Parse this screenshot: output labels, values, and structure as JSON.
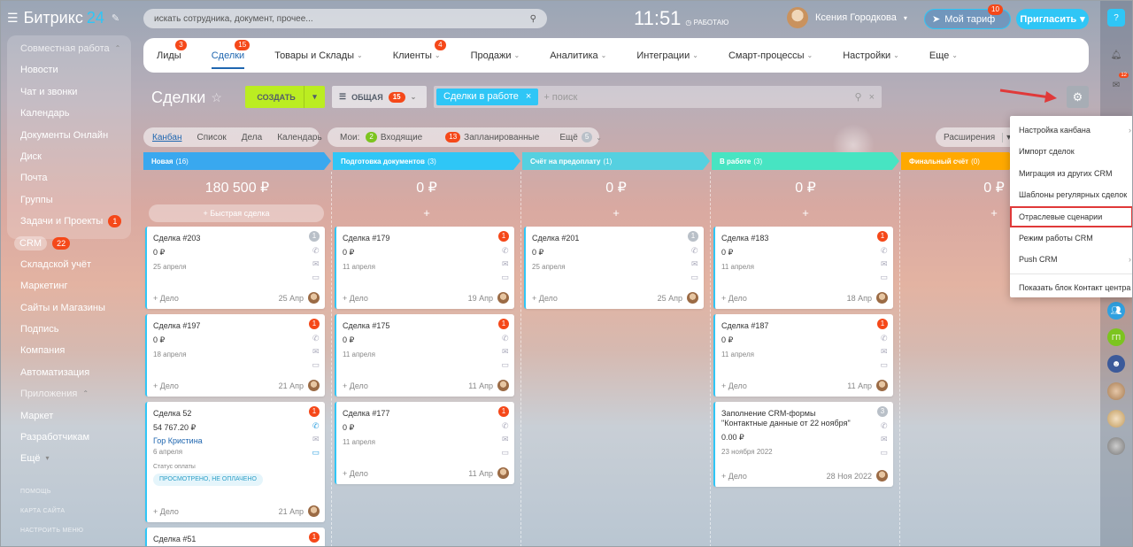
{
  "app": {
    "logo_text": "Битрикс",
    "logo_num": "24"
  },
  "search": {
    "placeholder": "искать сотрудника, документ, прочее..."
  },
  "clock": {
    "time": "11:51",
    "status": "РАБОТАЮ"
  },
  "user": {
    "name": "Ксения Городкова"
  },
  "tariff": {
    "label": "Мой тариф",
    "badge": "10"
  },
  "invite": {
    "label": "Пригласить"
  },
  "sidebar": {
    "group1": "Совместная работа",
    "items": [
      "Новости",
      "Чат и звонки",
      "Календарь",
      "Документы Онлайн",
      "Диск",
      "Почта",
      "Группы"
    ],
    "tasks": "Задачи и Проекты",
    "tasks_badge": "1",
    "crm": "CRM",
    "crm_badge": "22",
    "items2": [
      "Складской учёт",
      "Маркетинг",
      "Сайты и Магазины",
      "Подпись",
      "Компания",
      "Автоматизация"
    ],
    "group2": "Приложения",
    "items3": [
      "Маркет",
      "Разработчикам",
      "Ещё"
    ],
    "footer": [
      "ПОМОЩЬ",
      "КАРТА САЙТА",
      "НАСТРОИТЬ МЕНЮ"
    ]
  },
  "tabs": [
    {
      "label": "Лиды",
      "badge": "3"
    },
    {
      "label": "Сделки",
      "badge": "15"
    },
    {
      "label": "Товары и Склады",
      "badge": ""
    },
    {
      "label": "Клиенты",
      "badge": "4"
    },
    {
      "label": "Продажи",
      "badge": ""
    },
    {
      "label": "Аналитика",
      "badge": ""
    },
    {
      "label": "Интеграции",
      "badge": ""
    },
    {
      "label": "Смарт-процессы",
      "badge": ""
    },
    {
      "label": "Настройки",
      "badge": ""
    },
    {
      "label": "Еще",
      "badge": ""
    }
  ],
  "toolbar": {
    "title": "Сделки",
    "create": "СОЗДАТЬ",
    "filter": "ОБЩАЯ",
    "filter_badge": "15",
    "chip": "Сделки в работе",
    "search_placeholder": "+ поиск"
  },
  "views": {
    "items": [
      "Канбан",
      "Список",
      "Дела",
      "Календарь"
    ],
    "mine": "Мои:",
    "incoming_badge": "2",
    "incoming": "Входящие",
    "planned_badge": "13",
    "planned": "Запланированные",
    "more": "Ещё",
    "more_badge": "5",
    "extended": "Расширения"
  },
  "columns": [
    {
      "name": "Новая",
      "count": "(16)",
      "sum": "180 500 ₽",
      "color": "#39a8ef"
    },
    {
      "name": "Подготовка документов",
      "count": "(3)",
      "sum": "0 ₽",
      "color": "#2fc6f6"
    },
    {
      "name": "Счёт на предоплату",
      "count": "(1)",
      "sum": "0 ₽",
      "color": "#55d0e0"
    },
    {
      "name": "В работе",
      "count": "(3)",
      "sum": "0 ₽",
      "color": "#47e4c2"
    },
    {
      "name": "Финальный счёт",
      "count": "(0)",
      "sum": "0 ₽",
      "color": "#ffa900"
    }
  ],
  "quick_deal": "+ Быстрая сделка",
  "cards": {
    "c1": [
      {
        "title": "Сделка #203",
        "amount": "0 ₽",
        "date": "25 апреля",
        "count": "1",
        "foot": "+ Дело",
        "fdate": "25 Апр"
      },
      {
        "title": "Сделка #197",
        "amount": "0 ₽",
        "date": "18 апреля",
        "count": "1",
        "foot": "+ Дело",
        "fdate": "21 Апр"
      },
      {
        "title": "Сделка 52",
        "amount": "54 767.20 ₽",
        "contact": "Гор Кристина",
        "date": "6 апреля",
        "pay_label": "Статус оплаты",
        "pay_badge": "ПРОСМОТРЕНО, НЕ ОПЛАЧЕНО",
        "count": "1",
        "foot": "+ Дело",
        "fdate": "21 Апр"
      },
      {
        "title": "Сделка #51",
        "count": "1"
      }
    ],
    "c2": [
      {
        "title": "Сделка #179",
        "amount": "0 ₽",
        "date": "11 апреля",
        "count": "1",
        "foot": "+ Дело",
        "fdate": "19 Апр"
      },
      {
        "title": "Сделка #175",
        "amount": "0 ₽",
        "date": "11 апреля",
        "count": "1",
        "foot": "+ Дело",
        "fdate": "11 Апр"
      },
      {
        "title": "Сделка #177",
        "amount": "0 ₽",
        "date": "11 апреля",
        "count": "1",
        "foot": "+ Дело",
        "fdate": "11 Апр"
      }
    ],
    "c3": [
      {
        "title": "Сделка #201",
        "amount": "0 ₽",
        "date": "25 апреля",
        "count": "1",
        "foot": "+ Дело",
        "fdate": "25 Апр"
      }
    ],
    "c4": [
      {
        "title": "Сделка #183",
        "amount": "0 ₽",
        "date": "11 апреля",
        "count": "1",
        "foot": "+ Дело",
        "fdate": "18 Апр"
      },
      {
        "title": "Сделка #187",
        "amount": "0 ₽",
        "date": "11 апреля",
        "count": "1",
        "foot": "+ Дело",
        "fdate": "11 Апр"
      },
      {
        "title": "Заполнение CRM-формы \"Контактные данные от 22 ноября\"",
        "amount": "0.00 ₽",
        "date": "23 ноября 2022",
        "count": "3",
        "foot": "+ Дело",
        "fdate": "28 Ноя 2022"
      }
    ]
  },
  "dropdown": [
    "Настройка канбана",
    "Импорт сделок",
    "Миграция из других CRM",
    "Шаблоны регулярных сделок",
    "Отраслевые сценарии",
    "Режим работы CRM",
    "Push CRM",
    "Показать блок Контакт центра"
  ],
  "right_icons": {
    "notify_badge": "12",
    "avatar_text": "ГП"
  },
  "colors": {
    "accent": "#2fc6f6",
    "create": "#bbed21",
    "badge": "#f54819",
    "link": "#2067b0",
    "highlight": "#e03939"
  }
}
